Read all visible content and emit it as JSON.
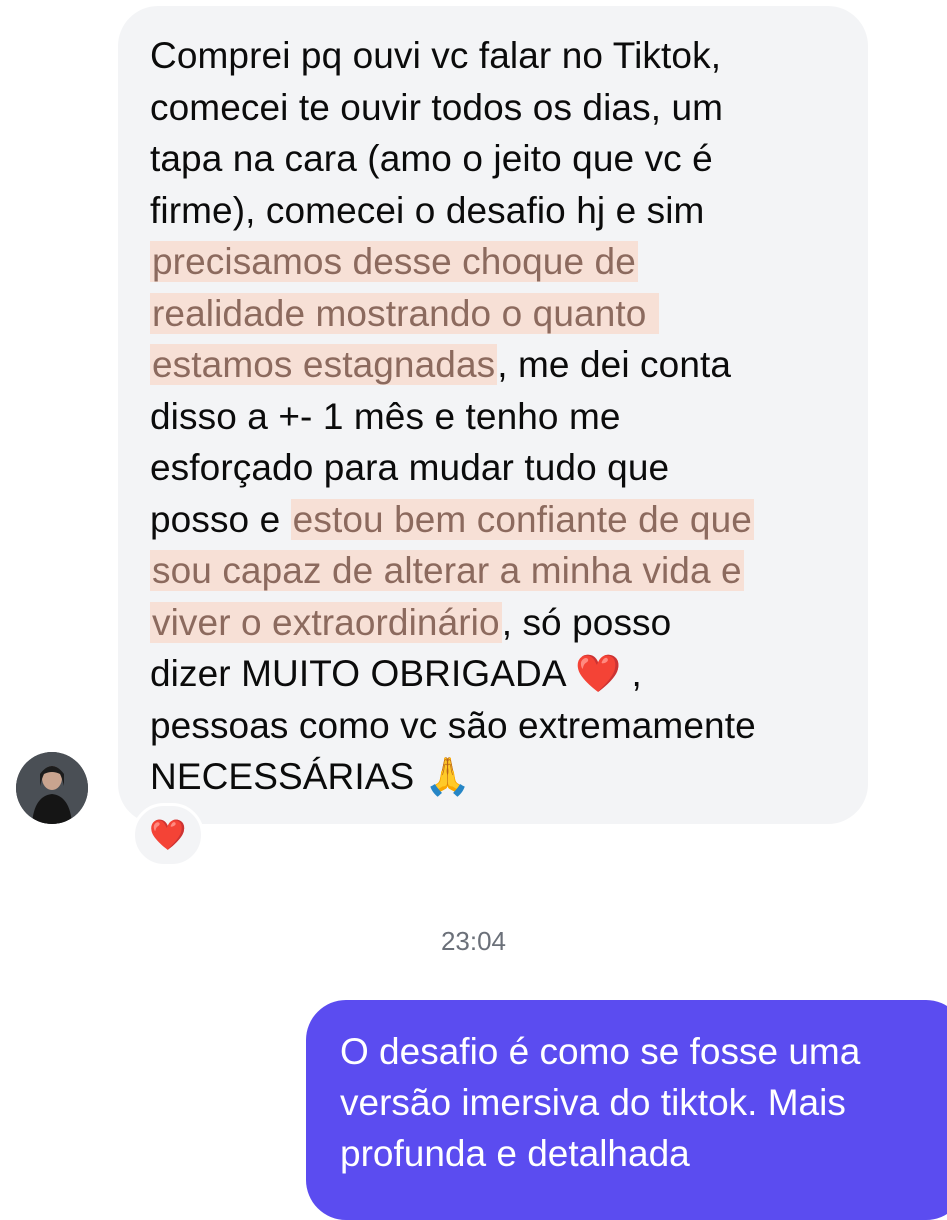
{
  "incoming_message": {
    "lines": [
      {
        "pre": "Comprei pq ouvi vc falar no Tiktok,",
        "hl": "",
        "post": ""
      },
      {
        "pre": "comecei te ouvir todos os dias, um",
        "hl": "",
        "post": ""
      },
      {
        "pre": "tapa na cara (amo o jeito que vc é",
        "hl": "",
        "post": ""
      },
      {
        "pre": "firme), comecei o desafio hj e sim",
        "hl": "",
        "post": ""
      },
      {
        "pre": "",
        "hl": "precisamos desse choque de",
        "post": ""
      },
      {
        "pre": "",
        "hl": "realidade mostrando o quanto ",
        "post": ""
      },
      {
        "pre": "",
        "hl": "estamos estagnadas",
        "post": ", me dei conta"
      },
      {
        "pre": "disso a +- 1 mês e tenho me",
        "hl": "",
        "post": ""
      },
      {
        "pre": "esforçado para mudar tudo que",
        "hl": "",
        "post": ""
      },
      {
        "pre": "posso e ",
        "hl": "estou bem confiante de que",
        "post": ""
      },
      {
        "pre": "",
        "hl": "sou capaz de alterar a minha vida e",
        "post": ""
      },
      {
        "pre": "",
        "hl": "viver o extraordinário",
        "post": ", só posso"
      },
      {
        "pre": "dizer MUITO OBRIGADA ",
        "hl": "",
        "post": "",
        "emoji": "❤️",
        "after": " ,"
      },
      {
        "pre": "pessoas como vc são extremamente",
        "hl": "",
        "post": ""
      },
      {
        "pre": "NECESSÁRIAS ",
        "hl": "",
        "post": "",
        "emoji": "🙏",
        "after": ""
      }
    ],
    "reaction": "❤️"
  },
  "timestamp": "23:04",
  "outgoing_message": {
    "lines": [
      "O desafio é como se fosse uma",
      "versão imersiva do tiktok. Mais",
      "profunda e detalhada"
    ]
  },
  "colors": {
    "incoming_bubble": "#f3f4f6",
    "outgoing_bubble": "#5b4cf0",
    "highlight_bg": "#f7e0d6",
    "highlight_text": "#8c6a5e"
  }
}
